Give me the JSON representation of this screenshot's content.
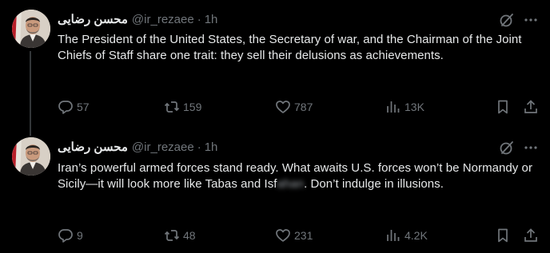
{
  "tweets": [
    {
      "author": {
        "display_name": "محسن رضایی",
        "handle": "@ir_rezaee",
        "separator": "·",
        "time": "1h"
      },
      "text_parts": [
        "The President of the United States, the Secretary of war, and the Chairman of the Joint Chiefs of Staff share one trait: they sell their delusions as achievements."
      ],
      "stats": {
        "replies": "57",
        "reposts": "159",
        "likes": "787",
        "views": "13K"
      }
    },
    {
      "author": {
        "display_name": "محسن رضایی",
        "handle": "@ir_rezaee",
        "separator": "·",
        "time": "1h"
      },
      "text_parts": [
        "Iran’s powerful armed forces stand ready. What awaits U.S. forces won’t be Normandy or Sicily—it will look more like Tabas and Isf",
        "ahan",
        ". Don’t indulge in illusions."
      ],
      "stats": {
        "replies": "9",
        "reposts": "48",
        "likes": "231",
        "views": "4.2K"
      }
    }
  ],
  "icons": {
    "reply": "reply-icon",
    "repost": "repost-icon",
    "like": "heart-icon",
    "views": "views-bar-chart-icon",
    "bookmark": "bookmark-icon",
    "share": "share-upload-icon",
    "grok": "grok-icon",
    "more": "more-dots-icon"
  },
  "colors": {
    "background": "#000000",
    "text_primary": "#e7e9ea",
    "text_secondary": "#71767b",
    "thread_line": "#333639"
  }
}
